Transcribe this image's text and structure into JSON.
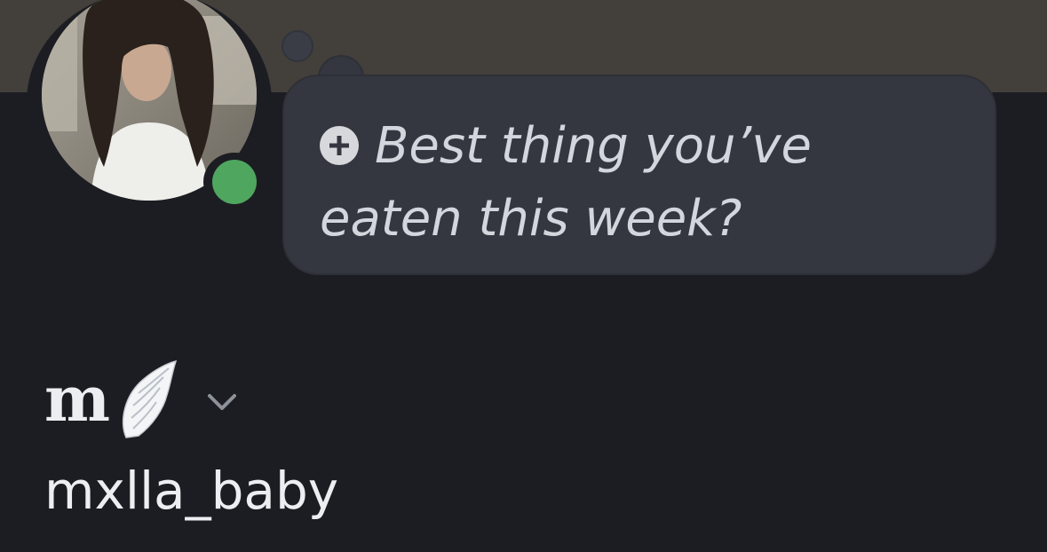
{
  "profile": {
    "status_bubble": {
      "icon": "add-icon",
      "text": "Best thing you’ve eaten this week?"
    },
    "display_name": "m",
    "display_name_emoji": "wing-icon",
    "username": "mxlla_baby",
    "online_status": "online",
    "colors": {
      "banner": "#433f3b",
      "background": "#1c1d22",
      "bubble": "#343740",
      "status_online": "#4fa65f",
      "text_primary": "#eceef1",
      "text_bubble": "#d3d6dc"
    }
  }
}
